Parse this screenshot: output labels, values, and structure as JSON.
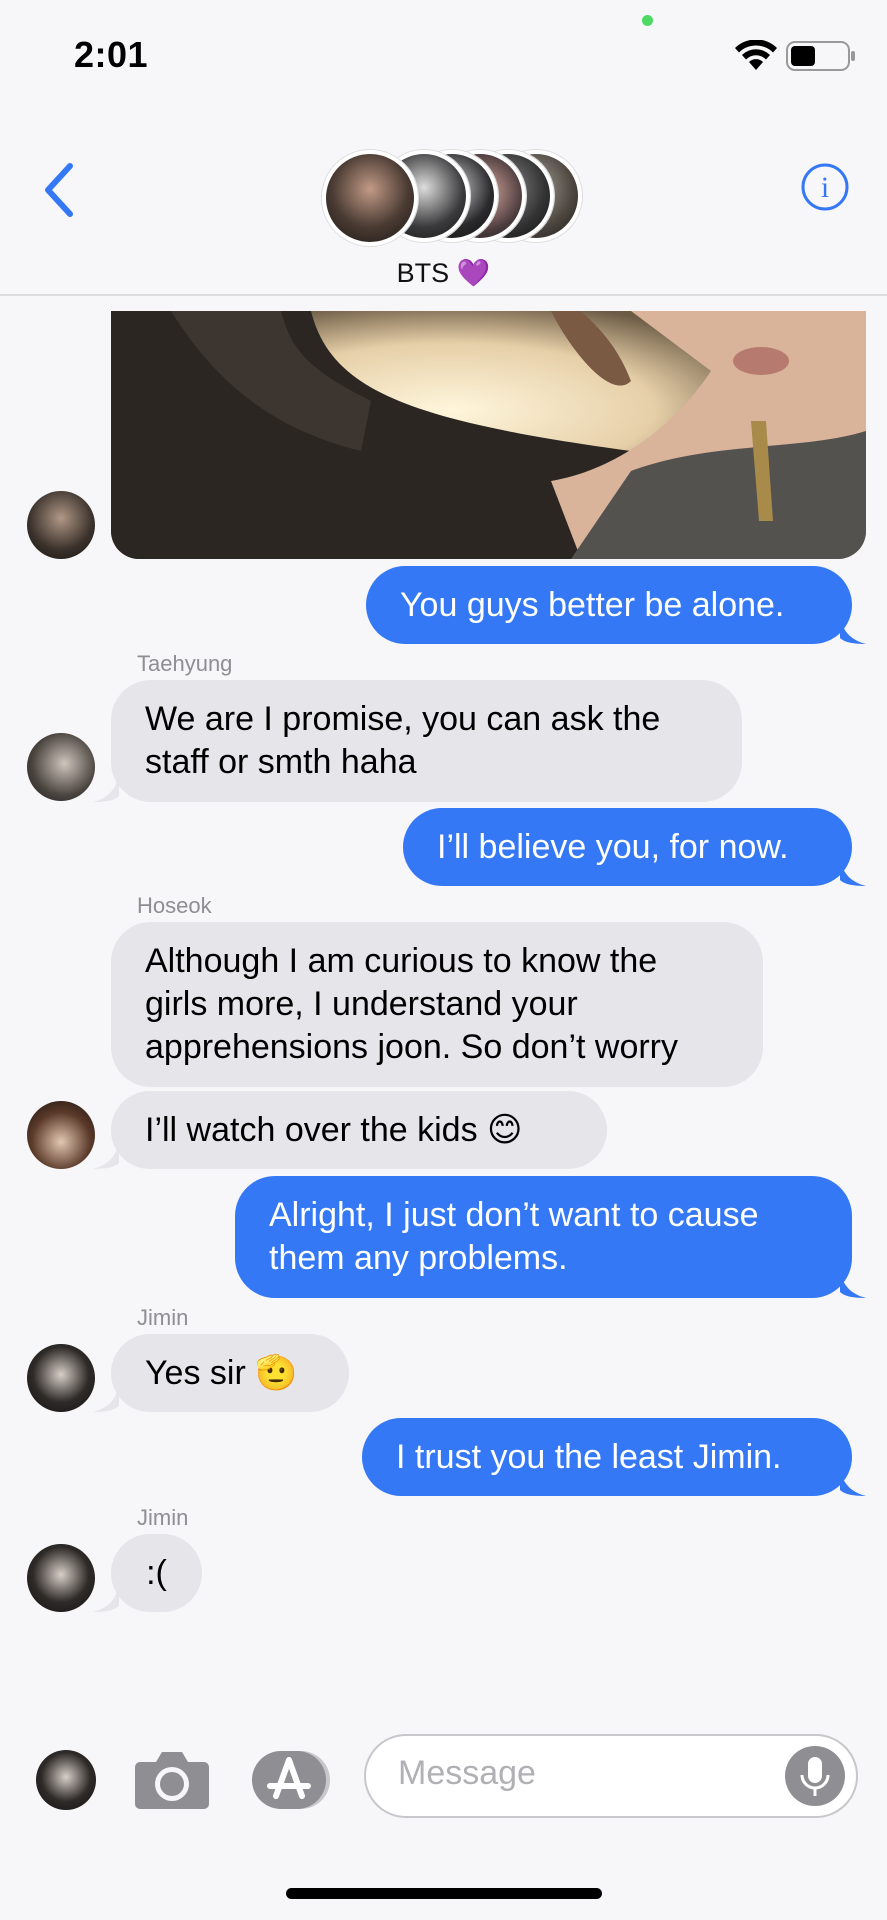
{
  "status_bar": {
    "time": "2:01",
    "battery_level": 0.45
  },
  "header": {
    "group_name": "BTS 💜",
    "back_icon": "chevron-left-icon",
    "info_icon": "info-icon"
  },
  "messages": [
    {
      "type": "photo",
      "direction": "in"
    },
    {
      "type": "text",
      "direction": "out",
      "text": "You guys better be alone."
    },
    {
      "type": "text",
      "direction": "in",
      "sender": "Taehyung",
      "text": "We are I promise, you can ask the\nstaff or smth haha"
    },
    {
      "type": "text",
      "direction": "out",
      "text": "I’ll believe you, for now."
    },
    {
      "type": "text",
      "direction": "in",
      "sender": "Hoseok",
      "text": "Although I am curious to know the\ngirls more, I understand your\napprehensions joon. So don’t worry"
    },
    {
      "type": "text",
      "direction": "in",
      "text": "I’ll watch over the kids 😊"
    },
    {
      "type": "text",
      "direction": "out",
      "text": "Alright, I just don’t want to cause\nthem any problems."
    },
    {
      "type": "text",
      "direction": "in",
      "sender": "Jimin",
      "text": "Yes sir 🫡"
    },
    {
      "type": "text",
      "direction": "out",
      "text": "I trust you the least Jimin."
    },
    {
      "type": "text",
      "direction": "in",
      "sender": "Jimin",
      "text": ":("
    }
  ],
  "input": {
    "placeholder": "Message"
  },
  "colors": {
    "outgoing": "#3478f6",
    "incoming": "#e5e5ea",
    "accent": "#3478f6"
  }
}
